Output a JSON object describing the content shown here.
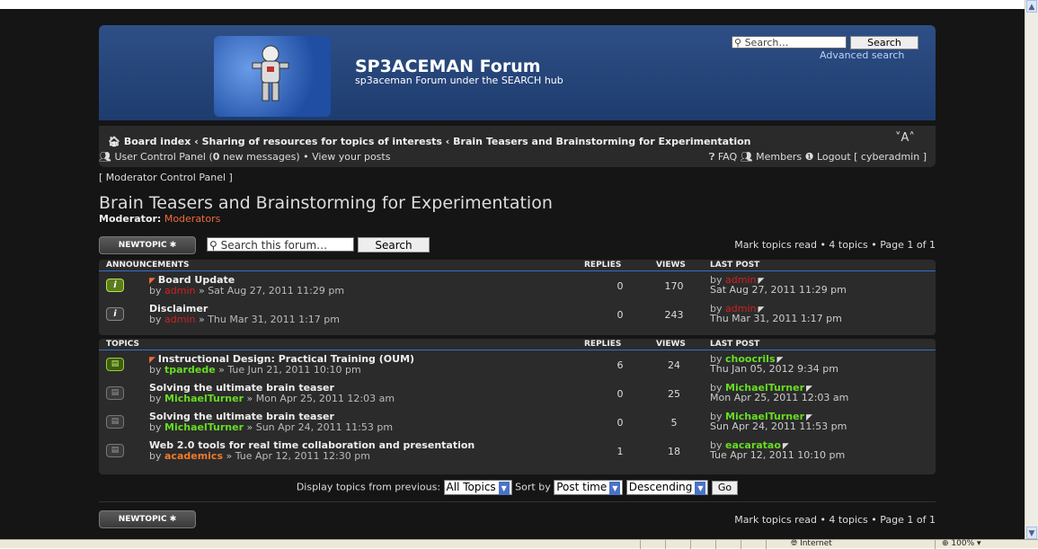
{
  "header": {
    "site_title": "SP3ACEMAN Forum",
    "site_description": "sp3aceman Forum under the SEARCH hub",
    "search_placeholder": "Search…",
    "search_button": "Search",
    "advanced_search": "Advanced search"
  },
  "navbar": {
    "breadcrumb": [
      "Board index",
      "Sharing of resources for topics of interests",
      "Brain Teasers and Brainstorming for Experimentation"
    ],
    "font_size": "˅A˄",
    "ucp": "User Control Panel",
    "new_messages_count": "0",
    "new_messages_suffix": "new messages)",
    "ucp_separator": "•",
    "view_posts": "View your posts",
    "faq": "FAQ",
    "members": "Members",
    "logout": "Logout [ cyberadmin ]"
  },
  "mcp": "[ Moderator Control Panel ]",
  "forum": {
    "title": "Brain Teasers and Brainstorming for Experimentation",
    "moderator_label": "Moderator:",
    "moderator_value": "Moderators"
  },
  "actions": {
    "new_topic": "NEWTOPIC ✱",
    "search_placeholder": "Search this forum…",
    "search_button": "Search",
    "pagination": "Mark topics read • 4 topics • Page 1 of 1"
  },
  "announcements": {
    "header": "ANNOUNCEMENTS",
    "col_replies": "REPLIES",
    "col_views": "VIEWS",
    "col_last": "LAST POST",
    "rows": [
      {
        "title": "Board Update",
        "by": "by",
        "author": "admin",
        "date": "» Sat Aug 27, 2011 11:29 pm",
        "replies": "0",
        "views": "170",
        "last_by": "by",
        "last_author": "admin",
        "last_date": "Sat Aug 27, 2011 11:29 pm"
      },
      {
        "title": "Disclaimer",
        "by": "by",
        "author": "admin",
        "date": "» Thu Mar 31, 2011 1:17 pm",
        "replies": "0",
        "views": "243",
        "last_by": "by",
        "last_author": "admin",
        "last_date": "Thu Mar 31, 2011 1:17 pm"
      }
    ]
  },
  "topics": {
    "header": "TOPICS",
    "col_replies": "REPLIES",
    "col_views": "VIEWS",
    "col_last": "LAST POST",
    "rows": [
      {
        "title": "Instructional Design: Practical Training (OUM)",
        "by": "by",
        "author": "tpardede",
        "date": "» Tue Jun 21, 2011 10:10 pm",
        "replies": "6",
        "views": "24",
        "last_by": "by",
        "last_author": "choocrils",
        "last_date": "Thu Jan 05, 2012 9:34 pm"
      },
      {
        "title": "Solving the ultimate brain teaser",
        "by": "by",
        "author": "MichaelTurner",
        "date": "» Mon Apr 25, 2011 12:03 am",
        "replies": "0",
        "views": "25",
        "last_by": "by",
        "last_author": "MichaelTurner",
        "last_date": "Mon Apr 25, 2011 12:03 am"
      },
      {
        "title": "Solving the ultimate brain teaser",
        "by": "by",
        "author": "MichaelTurner",
        "date": "» Sun Apr 24, 2011 11:53 pm",
        "replies": "0",
        "views": "5",
        "last_by": "by",
        "last_author": "MichaelTurner",
        "last_date": "Sun Apr 24, 2011 11:53 pm"
      },
      {
        "title": "Web 2.0 tools for real time collaboration and presentation",
        "by": "by",
        "author": "academics",
        "date": "» Tue Apr 12, 2011 12:30 pm",
        "replies": "1",
        "views": "18",
        "last_by": "by",
        "last_author": "eacaratao",
        "last_date": "Tue Apr 12, 2011 10:10 pm"
      }
    ]
  },
  "display": {
    "label": "Display topics from previous:",
    "topics_value": "All Topics",
    "sort_label": "Sort by",
    "sort_value": "Post time",
    "order_value": "Descending",
    "go": "Go"
  },
  "statusbar": {
    "zone": "Internet",
    "zoom": "100%"
  }
}
